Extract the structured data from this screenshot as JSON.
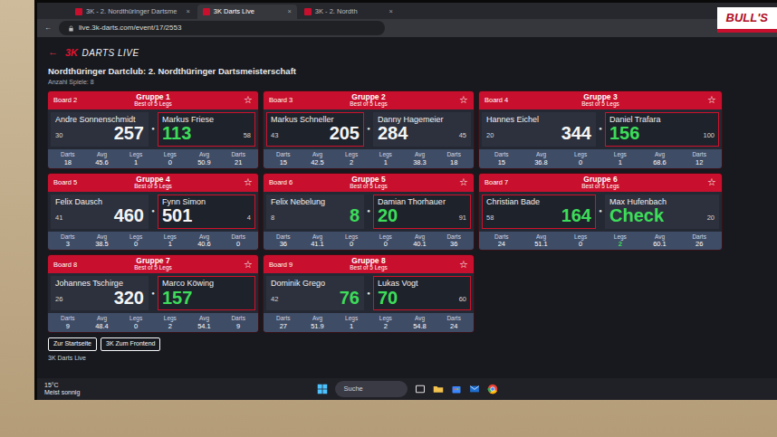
{
  "browser": {
    "tabs": [
      {
        "label": "3K - 2. Nordthüringer Dartsme",
        "selected": false
      },
      {
        "label": "3K Darts Live",
        "selected": true
      },
      {
        "label": "3K - 2. Nordth",
        "selected": false
      }
    ],
    "close": "×",
    "back": "←",
    "address": "live.3k-darts.com/event/17/2553"
  },
  "banner": "BULL'S",
  "app": {
    "back": "←",
    "logo_mark": "3K",
    "logo_text": "DARTS LIVE",
    "event": "Nordthüringer Dartclub: 2. Nordthüringer Dartsmeisterschaft",
    "count": "Anzahl Spiele: 8"
  },
  "labels": {
    "darts": "Darts",
    "avg": "Avg",
    "legs": "Legs"
  },
  "matches": [
    {
      "board": "Board 2",
      "group": "Gruppe 1",
      "format": "Best of 5 Legs",
      "star": "☆",
      "dot": "●",
      "players": [
        {
          "name": "Andre Sonnenschmidt",
          "last": "30",
          "score": "257",
          "darts": "18",
          "avg": "45.6",
          "legs": "1",
          "throwing": false,
          "finishable": false,
          "winner": false
        },
        {
          "name": "Markus Friese",
          "last": "58",
          "score": "113",
          "darts": "21",
          "avg": "50.9",
          "legs": "0",
          "throwing": true,
          "finishable": true,
          "winner": false
        }
      ]
    },
    {
      "board": "Board 3",
      "group": "Gruppe 2",
      "format": "Best of 5 Legs",
      "star": "☆",
      "dot": "●",
      "players": [
        {
          "name": "Markus Schneller",
          "last": "43",
          "score": "205",
          "darts": "15",
          "avg": "42.5",
          "legs": "2",
          "throwing": true,
          "finishable": false,
          "winner": false
        },
        {
          "name": "Danny Hagemeier",
          "last": "45",
          "score": "284",
          "darts": "18",
          "avg": "38.3",
          "legs": "1",
          "throwing": false,
          "finishable": false,
          "winner": false
        }
      ]
    },
    {
      "board": "Board 4",
      "group": "Gruppe 3",
      "format": "Best of 5 Legs",
      "star": "☆",
      "dot": "●",
      "players": [
        {
          "name": "Hannes Eichel",
          "last": "20",
          "score": "344",
          "darts": "15",
          "avg": "36.8",
          "legs": "0",
          "throwing": false,
          "finishable": false,
          "winner": false
        },
        {
          "name": "Daniel Trafara",
          "last": "100",
          "score": "156",
          "darts": "12",
          "avg": "68.6",
          "legs": "1",
          "throwing": true,
          "finishable": true,
          "winner": false
        }
      ]
    },
    {
      "board": "Board 5",
      "group": "Gruppe 4",
      "format": "Best of 5 Legs",
      "star": "☆",
      "dot": "●",
      "players": [
        {
          "name": "Felix Dausch",
          "last": "41",
          "score": "460",
          "darts": "3",
          "avg": "38.5",
          "legs": "0",
          "throwing": false,
          "finishable": false,
          "winner": false
        },
        {
          "name": "Fynn Simon",
          "last": "4",
          "score": "501",
          "darts": "0",
          "avg": "40.6",
          "legs": "1",
          "throwing": true,
          "finishable": false,
          "winner": false
        }
      ]
    },
    {
      "board": "Board 6",
      "group": "Gruppe 5",
      "format": "Best of 5 Legs",
      "star": "☆",
      "dot": "●",
      "players": [
        {
          "name": "Felix Nebelung",
          "last": "8",
          "score": "8",
          "darts": "36",
          "avg": "41.1",
          "legs": "0",
          "throwing": false,
          "finishable": true,
          "winner": false
        },
        {
          "name": "Damian Thorhauer",
          "last": "91",
          "score": "20",
          "darts": "36",
          "avg": "40.1",
          "legs": "0",
          "throwing": true,
          "finishable": true,
          "winner": false
        }
      ]
    },
    {
      "board": "Board 7",
      "group": "Gruppe 6",
      "format": "Best of 5 Legs",
      "star": "☆",
      "dot": "●",
      "players": [
        {
          "name": "Christian Bade",
          "last": "58",
          "score": "164",
          "darts": "24",
          "avg": "51.1",
          "legs": "0",
          "throwing": true,
          "finishable": true,
          "winner": false
        },
        {
          "name": "Max Hufenbach",
          "last": "20",
          "score": "Check",
          "darts": "26",
          "avg": "60.1",
          "legs": "2",
          "throwing": false,
          "finishable": true,
          "winner": true
        }
      ]
    },
    {
      "board": "Board 8",
      "group": "Gruppe 7",
      "format": "Best of 5 Legs",
      "star": "☆",
      "dot": "●",
      "players": [
        {
          "name": "Johannes Tschirge",
          "last": "26",
          "score": "320",
          "darts": "9",
          "avg": "48.4",
          "legs": "0",
          "throwing": false,
          "finishable": false,
          "winner": false
        },
        {
          "name": "Marco Köwing",
          "score": "157",
          "darts": "9",
          "avg": "54.1",
          "legs": "2",
          "throwing": true,
          "finishable": true,
          "winner": false
        }
      ]
    },
    {
      "board": "Board 9",
      "group": "Gruppe 8",
      "format": "Best of 5 Legs",
      "star": "☆",
      "dot": "●",
      "players": [
        {
          "name": "Dominik Grego",
          "last": "42",
          "score": "76",
          "darts": "27",
          "avg": "51.9",
          "legs": "1",
          "throwing": false,
          "finishable": true,
          "winner": false
        },
        {
          "name": "Lukas Vogt",
          "last": "60",
          "score": "70",
          "darts": "24",
          "avg": "54.8",
          "legs": "2",
          "throwing": true,
          "finishable": true,
          "winner": false
        }
      ]
    }
  ],
  "footer": {
    "buttons": [
      "Zur Startseite",
      "3K Zum Frontend"
    ],
    "brand": "3K Darts Live"
  },
  "taskbar": {
    "temp": "15°C",
    "weather": "Meist sonnig",
    "search": "Suche"
  }
}
